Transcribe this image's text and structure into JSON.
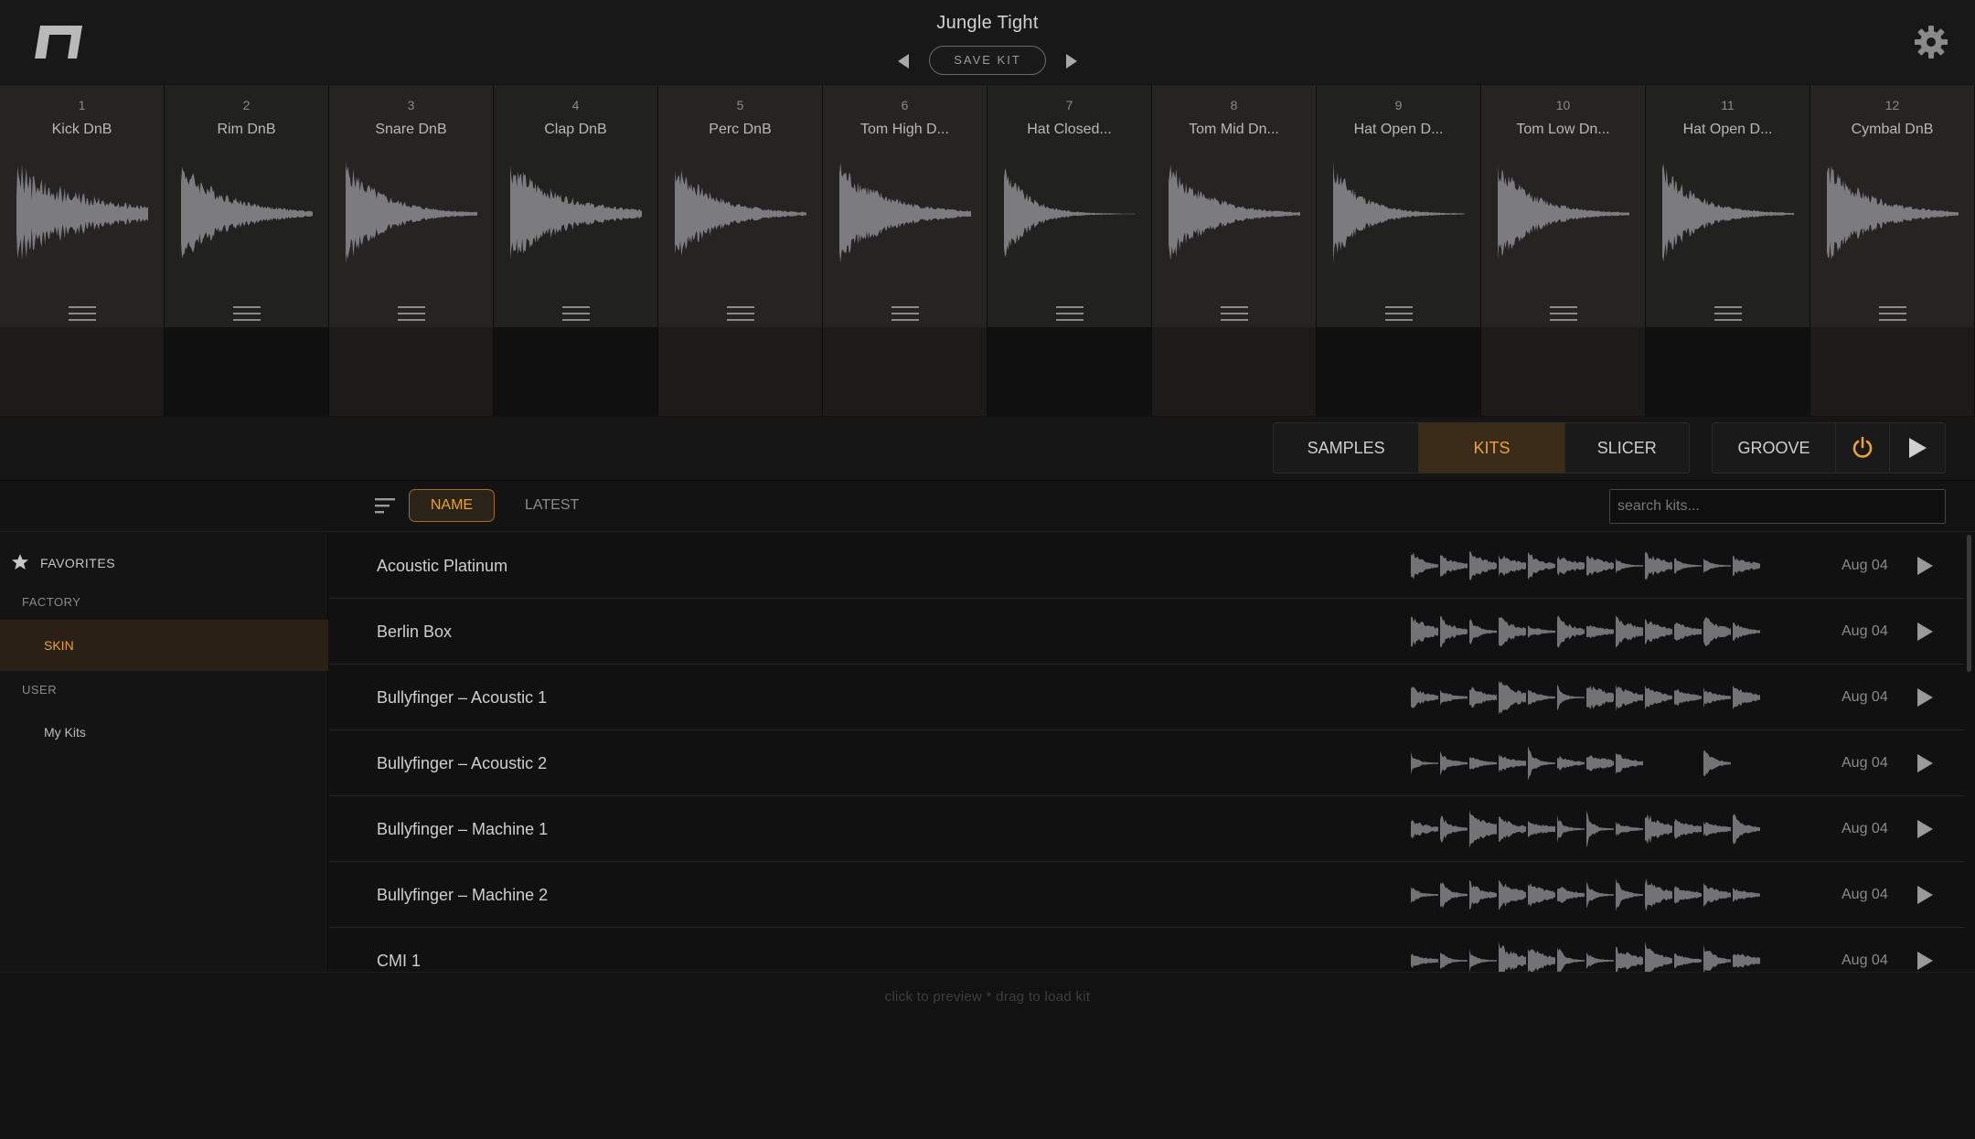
{
  "header": {
    "kit_name": "Jungle Tight",
    "save_label": "SAVE KIT",
    "icons": [
      "logo",
      "chevron-left-icon",
      "chevron-right-icon",
      "gear-icon"
    ]
  },
  "pads": [
    {
      "number": "1",
      "name": "Kick DnB"
    },
    {
      "number": "2",
      "name": "Rim DnB"
    },
    {
      "number": "3",
      "name": "Snare DnB"
    },
    {
      "number": "4",
      "name": "Clap DnB"
    },
    {
      "number": "5",
      "name": "Perc DnB"
    },
    {
      "number": "6",
      "name": "Tom High D..."
    },
    {
      "number": "7",
      "name": "Hat Closed..."
    },
    {
      "number": "8",
      "name": "Tom Mid Dn..."
    },
    {
      "number": "9",
      "name": "Hat Open D..."
    },
    {
      "number": "10",
      "name": "Tom Low Dn..."
    },
    {
      "number": "11",
      "name": "Hat Open D..."
    },
    {
      "number": "12",
      "name": "Cymbal DnB"
    }
  ],
  "tabs": {
    "samples": "SAMPLES",
    "kits": "KITS",
    "slicer": "SLICER",
    "groove": "GROOVE",
    "active": "KITS"
  },
  "sort": {
    "name_label": "NAME",
    "latest_label": "LATEST",
    "active": "NAME",
    "search_placeholder": "search kits..."
  },
  "sidebar": {
    "favorites": "FAVORITES",
    "factory_header": "FACTORY",
    "factory_items": [
      "SKIN"
    ],
    "user_header": "USER",
    "user_items": [
      "My Kits"
    ],
    "selected": "SKIN"
  },
  "kits": [
    {
      "name": "Acoustic Platinum",
      "date": "Aug 04"
    },
    {
      "name": "Berlin Box",
      "date": "Aug 04"
    },
    {
      "name": "Bullyfinger – Acoustic 1",
      "date": "Aug 04"
    },
    {
      "name": "Bullyfinger – Acoustic 2",
      "date": "Aug 04"
    },
    {
      "name": "Bullyfinger – Machine 1",
      "date": "Aug 04"
    },
    {
      "name": "Bullyfinger – Machine 2",
      "date": "Aug 04"
    },
    {
      "name": "CMI 1",
      "date": "Aug 04"
    }
  ],
  "footer": {
    "hint": "click to preview  *  drag to load kit"
  },
  "colors": {
    "accent": "#e8a23a",
    "accent_bg": "#3a2c18",
    "background": "#121212",
    "waveform": "#8c8c90"
  }
}
